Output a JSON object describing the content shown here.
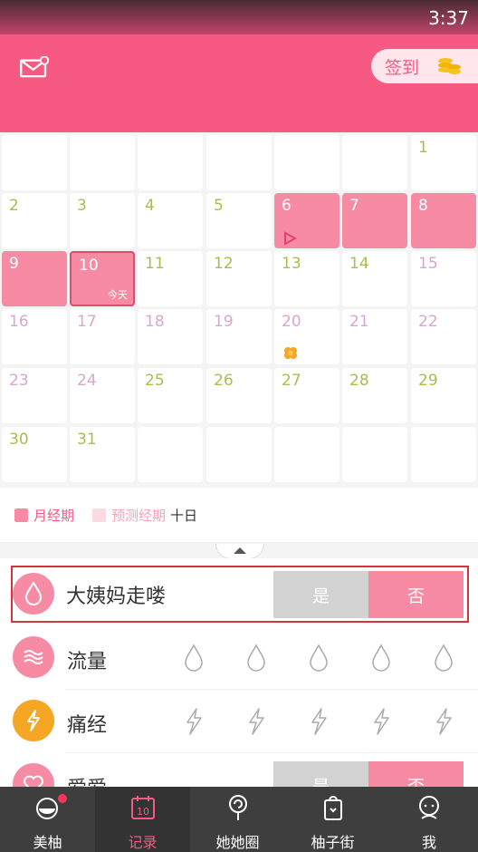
{
  "status_bar": {
    "time": "3:37"
  },
  "header": {
    "signin_label": "签到"
  },
  "calendar": {
    "days": [
      {
        "num": "",
        "col": 0,
        "row": 0
      },
      {
        "num": "",
        "col": 1,
        "row": 0
      },
      {
        "num": "",
        "col": 2,
        "row": 0
      },
      {
        "num": "",
        "col": 3,
        "row": 0
      },
      {
        "num": "",
        "col": 4,
        "row": 0
      },
      {
        "num": "",
        "col": 5,
        "row": 0
      },
      {
        "num": "1",
        "col": 6,
        "row": 0
      },
      {
        "num": "2",
        "col": 0,
        "row": 1
      },
      {
        "num": "3",
        "col": 1,
        "row": 1
      },
      {
        "num": "4",
        "col": 2,
        "row": 1
      },
      {
        "num": "5",
        "col": 3,
        "row": 1
      },
      {
        "num": "6",
        "col": 4,
        "row": 1,
        "state": "period",
        "marker": "play"
      },
      {
        "num": "7",
        "col": 5,
        "row": 1,
        "state": "period"
      },
      {
        "num": "8",
        "col": 6,
        "row": 1,
        "state": "period"
      },
      {
        "num": "9",
        "col": 0,
        "row": 2,
        "state": "period"
      },
      {
        "num": "10",
        "col": 1,
        "row": 2,
        "state": "period",
        "today": "今天"
      },
      {
        "num": "11",
        "col": 2,
        "row": 2
      },
      {
        "num": "12",
        "col": 3,
        "row": 2
      },
      {
        "num": "13",
        "col": 4,
        "row": 2
      },
      {
        "num": "14",
        "col": 5,
        "row": 2
      },
      {
        "num": "15",
        "col": 6,
        "row": 2,
        "state": "pink"
      },
      {
        "num": "16",
        "col": 0,
        "row": 3,
        "state": "pink"
      },
      {
        "num": "17",
        "col": 1,
        "row": 3,
        "state": "pink"
      },
      {
        "num": "18",
        "col": 2,
        "row": 3,
        "state": "pink"
      },
      {
        "num": "19",
        "col": 3,
        "row": 3,
        "state": "pink"
      },
      {
        "num": "20",
        "col": 4,
        "row": 3,
        "state": "pink",
        "marker": "flower"
      },
      {
        "num": "21",
        "col": 5,
        "row": 3,
        "state": "pink"
      },
      {
        "num": "22",
        "col": 6,
        "row": 3,
        "state": "pink"
      },
      {
        "num": "23",
        "col": 0,
        "row": 4,
        "state": "pink"
      },
      {
        "num": "24",
        "col": 1,
        "row": 4,
        "state": "pink"
      },
      {
        "num": "25",
        "col": 2,
        "row": 4
      },
      {
        "num": "26",
        "col": 3,
        "row": 4
      },
      {
        "num": "27",
        "col": 4,
        "row": 4
      },
      {
        "num": "28",
        "col": 5,
        "row": 4
      },
      {
        "num": "29",
        "col": 6,
        "row": 4
      },
      {
        "num": "30",
        "col": 0,
        "row": 5
      },
      {
        "num": "31",
        "col": 1,
        "row": 5
      },
      {
        "num": "",
        "col": 2,
        "row": 5
      },
      {
        "num": "",
        "col": 3,
        "row": 5
      },
      {
        "num": "",
        "col": 4,
        "row": 5
      },
      {
        "num": "",
        "col": 5,
        "row": 5
      },
      {
        "num": "",
        "col": 6,
        "row": 5
      }
    ],
    "colors": {
      "normal": "#a9bd4e",
      "pink": "#d9a6cf",
      "period_text": "#ffffff"
    }
  },
  "legend": {
    "period": "月经期",
    "predicted": "预测经期",
    "ovulation": "十日"
  },
  "records": {
    "period_gone": {
      "label": "大姨妈走喽",
      "yes": "是",
      "no": "否",
      "selected": "否"
    },
    "flow": {
      "label": "流量"
    },
    "cramps": {
      "label": "痛经"
    },
    "love": {
      "label": "爱爱",
      "yes": "是",
      "no": "否"
    }
  },
  "tabs": [
    {
      "label": "美柚",
      "icon": "grapefruit-icon"
    },
    {
      "label": "记录",
      "icon": "calendar-icon",
      "active": true
    },
    {
      "label": "她她圈",
      "icon": "lollipop-icon"
    },
    {
      "label": "柚子街",
      "icon": "bag-icon"
    },
    {
      "label": "我",
      "icon": "profile-icon"
    }
  ]
}
